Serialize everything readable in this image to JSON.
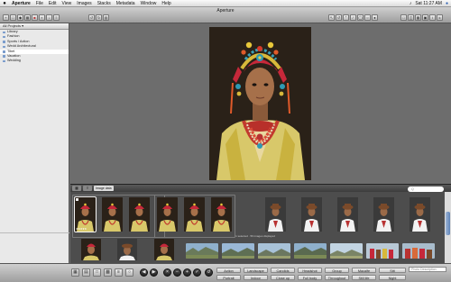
{
  "menubar": {
    "apple_icon": "apple-icon",
    "items": [
      "Aperture",
      "File",
      "Edit",
      "View",
      "Images",
      "Stacks",
      "Metadata",
      "Window",
      "Help"
    ],
    "clock": "Sat 11:27 AM"
  },
  "window": {
    "title": "Aperture"
  },
  "sidebar": {
    "header": "All Projects ▾",
    "items": [
      {
        "label": "Library"
      },
      {
        "label": "Fashion"
      },
      {
        "label": "Sports / Action"
      },
      {
        "label": "Wedd Architectural"
      },
      {
        "label": "Tibet",
        "selected": true
      },
      {
        "label": "Vacation"
      },
      {
        "label": "Wedding"
      }
    ],
    "footer": "Vault"
  },
  "browser": {
    "mode_button": "Image data",
    "search_placeholder": "Q",
    "caption": "1 selected · 56 images displayed",
    "selected_stars": "★★★★★"
  },
  "keywords": {
    "input_placeholder": "Photo Description",
    "row1": [
      "Action",
      "Landscape",
      "Candids",
      "Headshot",
      "Group",
      "Macalfe",
      "Sitt"
    ],
    "row2": [
      "Portrait",
      "Indoor",
      "Close up",
      "Full body",
      "Throughout",
      "Still life",
      "Night"
    ]
  },
  "accent": "#5e83b8"
}
